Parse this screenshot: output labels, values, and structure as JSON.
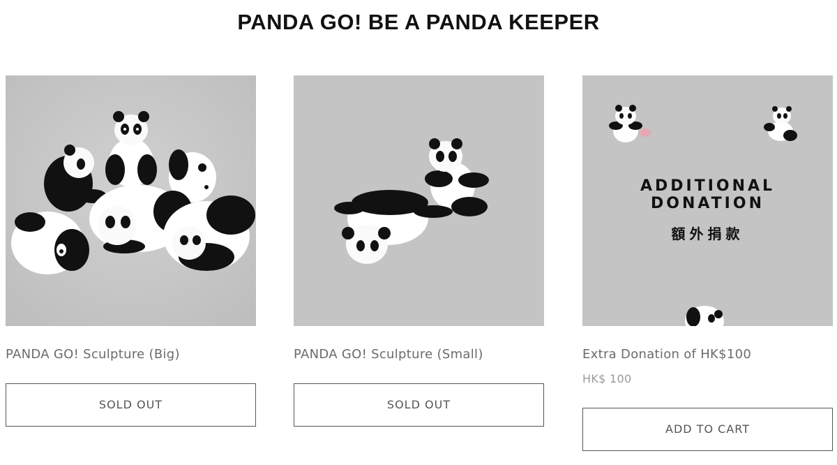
{
  "page": {
    "title": "PANDA GO! BE A PANDA KEEPER"
  },
  "products": [
    {
      "name": "PANDA GO! Sculpture (Big)",
      "button_label": "SOLD OUT",
      "image_icon": "panda-group-icon"
    },
    {
      "name": "PANDA GO! Sculpture (Small)",
      "button_label": "SOLD OUT",
      "image_icon": "panda-pair-icon"
    },
    {
      "name": "Extra Donation of HK$100",
      "price": "HK$ 100",
      "button_label": "ADD TO CART",
      "image_text": {
        "line1": "ADDITIONAL",
        "line2": "DONATION",
        "line3": "額外捐款"
      },
      "image_icon": "donation-panda-icon"
    }
  ],
  "colors": {
    "image_background": "#c3c4c3",
    "text_primary": "#111111",
    "text_secondary": "#6b6b6b",
    "price_text": "#9a9a9a",
    "button_border": "#555555"
  }
}
